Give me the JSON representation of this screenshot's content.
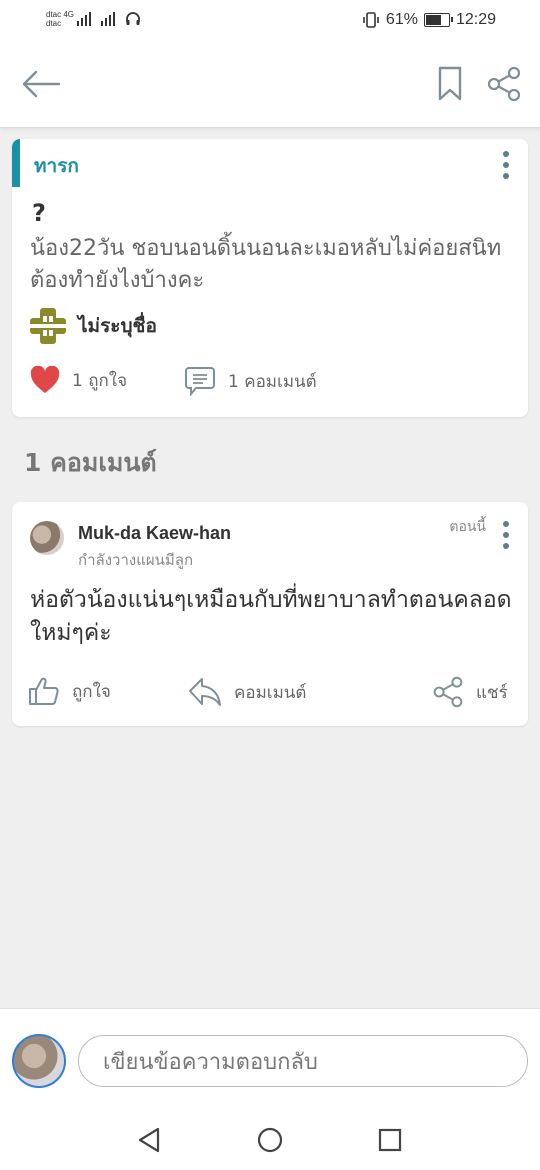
{
  "status_bar": {
    "carrier_1": "dtac",
    "network_1": "4G",
    "carrier_2": "dtac",
    "battery": "61%",
    "time": "12:29"
  },
  "app_bar": {
    "back_icon": "arrow-left-icon",
    "bookmark_icon": "bookmark-icon",
    "share_icon": "share-icon"
  },
  "post": {
    "tag": "ทารก",
    "title": "?",
    "body": "น้อง22วัน ชอบนอนดิ้นนอนละเมอหลับไม่ค่อยสนิทต้องทำยังไงบ้างคะ",
    "author": "ไม่ระบุชื่อ",
    "likes_label": "1 ถูกใจ",
    "comments_label": "1 คอมเมนต์",
    "accent_color": "#1a8fa6"
  },
  "comments_section": {
    "heading": "1 คอมเมนต์",
    "items": [
      {
        "name": "Muk-da Kaew-han",
        "subtitle": "กำลังวางแผนมีลูก",
        "time": "ตอนนี้",
        "body": "ห่อตัวน้องแน่นๆเหมือนกับที่พยาบาลทำตอนคลอดใหม่ๆค่ะ",
        "like_label": "ถูกใจ",
        "reply_label": "คอมเมนต์",
        "share_label": "แชร์"
      }
    ]
  },
  "reply_bar": {
    "placeholder": "เขียนข้อความตอบกลับ"
  },
  "nav_bar": {
    "back_icon": "triangle-back-icon",
    "home_icon": "circle-home-icon",
    "recents_icon": "square-recents-icon"
  }
}
